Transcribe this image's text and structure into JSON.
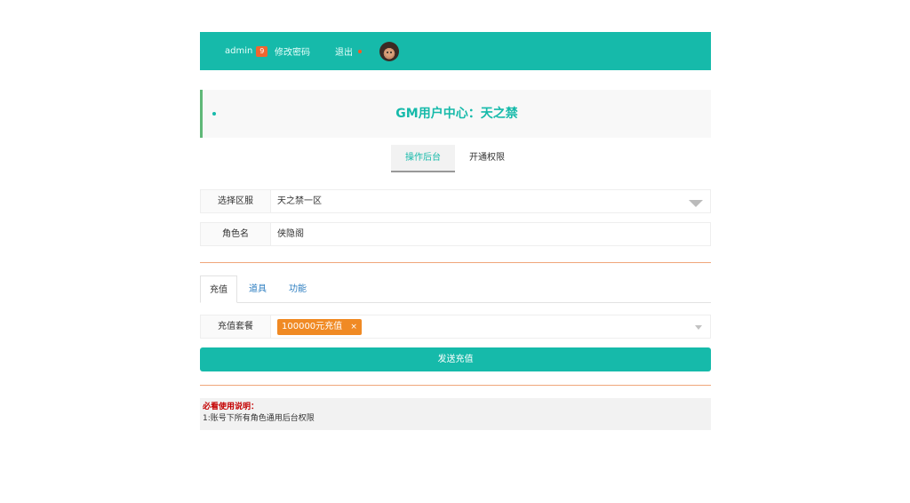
{
  "topbar": {
    "user": "admin",
    "badge": "9",
    "change_password": "修改密码",
    "logout": "退出"
  },
  "header": {
    "title": "GM用户中心：天之禁"
  },
  "main_tabs": [
    {
      "label": "操作后台",
      "active": true
    },
    {
      "label": "开通权限",
      "active": false
    }
  ],
  "form": {
    "server_label": "选择区服",
    "server_value": "天之禁一区",
    "role_label": "角色名",
    "role_value": "侠隐阁"
  },
  "sub_tabs": [
    {
      "label": "充值",
      "active": true
    },
    {
      "label": "道具",
      "active": false
    },
    {
      "label": "功能",
      "active": false
    }
  ],
  "recharge": {
    "package_label": "充值套餐",
    "selected_tag": "100000元充值",
    "tag_remove": "×",
    "send_button": "发送充值"
  },
  "notice": {
    "title": "必看使用说明：",
    "line1": "1:账号下所有角色通用后台权限"
  },
  "colors": {
    "primary": "#16baaa",
    "orange": "#f08a24",
    "badge": "#f06630",
    "notice_title": "#c40000"
  }
}
